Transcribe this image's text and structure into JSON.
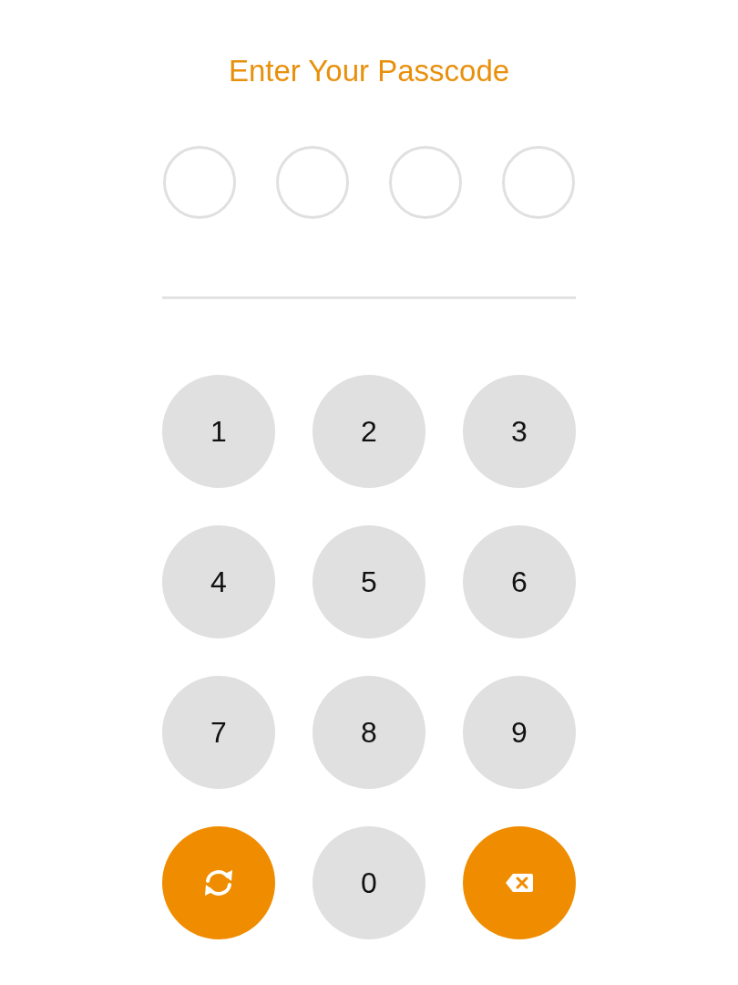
{
  "title": "Enter Your Passcode",
  "passcode_dots": [
    {
      "filled": false
    },
    {
      "filled": false
    },
    {
      "filled": false
    },
    {
      "filled": false
    }
  ],
  "keypad": [
    {
      "kind": "digit",
      "label": "1"
    },
    {
      "kind": "digit",
      "label": "2"
    },
    {
      "kind": "digit",
      "label": "3"
    },
    {
      "kind": "digit",
      "label": "4"
    },
    {
      "kind": "digit",
      "label": "5"
    },
    {
      "kind": "digit",
      "label": "6"
    },
    {
      "kind": "digit",
      "label": "7"
    },
    {
      "kind": "digit",
      "label": "8"
    },
    {
      "kind": "digit",
      "label": "9"
    },
    {
      "kind": "refresh"
    },
    {
      "kind": "digit",
      "label": "0"
    },
    {
      "kind": "backspace"
    }
  ]
}
